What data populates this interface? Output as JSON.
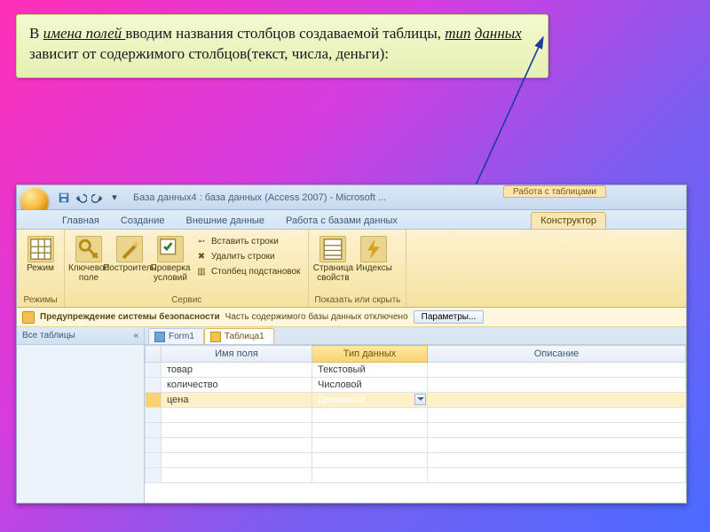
{
  "instruction": {
    "pre": "В ",
    "em1": "имена полей ",
    "mid1": "вводим названия столбцов создаваемой таблицы, ",
    "em2": "тип",
    "sp": " ",
    "em3": "данных",
    "post": " зависит от содержимого столбцов(текст, числа, деньги):"
  },
  "title": "База данных4 : база данных (Access 2007) - Microsoft ...",
  "contextual_group": "Работа с таблицами",
  "tabs": {
    "home": "Главная",
    "create": "Создание",
    "external": "Внешние данные",
    "dbtools": "Работа с базами данных",
    "design": "Конструктор"
  },
  "ribbon": {
    "group_modes": "Режимы",
    "group_service": "Сервис",
    "group_show": "Показать или скрыть",
    "mode": "Режим",
    "keyfield": "Ключевое поле",
    "builder": "Построитель",
    "test": "Проверка условий",
    "insert_rows": "Вставить строки",
    "delete_rows": "Удалить строки",
    "lookup_col": "Столбец подстановок",
    "prop_page": "Страница свойств",
    "indexes": "Индексы"
  },
  "security": {
    "title": "Предупреждение системы безопасности",
    "msg": "Часть содержимого базы данных отключено",
    "btn": "Параметры..."
  },
  "nav_header": "Все таблицы",
  "object_tabs": {
    "form": "Form1",
    "table": "Таблица1"
  },
  "columns": {
    "name": "Имя поля",
    "type": "Тип данных",
    "desc": "Описание"
  },
  "rows": [
    {
      "name": "товар",
      "type": "Текстовый"
    },
    {
      "name": "количество",
      "type": "Числовой"
    },
    {
      "name": "цена",
      "type": "Денежный"
    }
  ]
}
